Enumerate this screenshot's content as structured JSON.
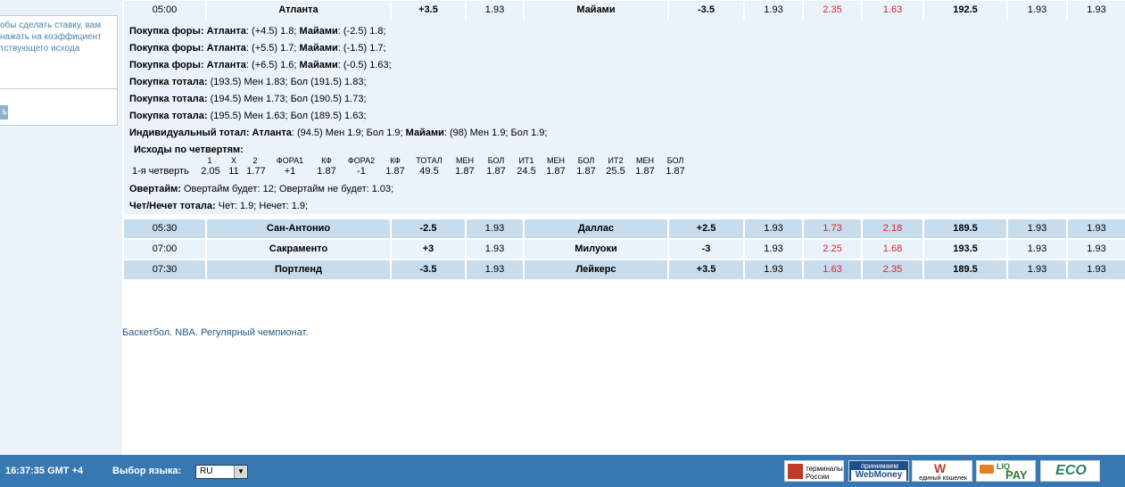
{
  "sidebar": {
    "lines": [
      "обы сделать ставку, вам",
      "нажать на коэффициент",
      "тствующего исхода"
    ],
    "button_label": "ь"
  },
  "matches": [
    {
      "time": "05:00",
      "team1": "Атланта",
      "fora1": "+3.5",
      "k1": "1.93",
      "team2": "Майами",
      "fora2": "-3.5",
      "k2": "1.93",
      "r1": "2.35",
      "r2": "1.63",
      "total": "192.5",
      "t1": "1.93",
      "t2": "1.93"
    },
    {
      "time": "05:30",
      "team1": "Сан-Антонио",
      "fora1": "-2.5",
      "k1": "1.93",
      "team2": "Даллас",
      "fora2": "+2.5",
      "k2": "1.93",
      "r1": "1.73",
      "r2": "2.18",
      "total": "189.5",
      "t1": "1.93",
      "t2": "1.93"
    },
    {
      "time": "07:00",
      "team1": "Сакраменто",
      "fora1": "+3",
      "k1": "1.93",
      "team2": "Милуоки",
      "fora2": "-3",
      "k2": "1.93",
      "r1": "2.25",
      "r2": "1.68",
      "total": "193.5",
      "t1": "1.93",
      "t2": "1.93"
    },
    {
      "time": "07:30",
      "team1": "Портленд",
      "fora1": "-3.5",
      "k1": "1.93",
      "team2": "Лейкерс",
      "fora2": "+3.5",
      "k2": "1.93",
      "r1": "1.63",
      "r2": "2.35",
      "total": "189.5",
      "t1": "1.93",
      "t2": "1.93"
    }
  ],
  "details": {
    "fora1": {
      "label": "Покупка форы:",
      "team1": "Атланта",
      "v1": ": (+4.5) 1.8;",
      "team2": "Майами",
      "v2": ": (-2.5) 1.8;"
    },
    "fora2": {
      "label": "Покупка форы:",
      "team1": "Атланта",
      "v1": ": (+5.5) 1.7;",
      "team2": "Майами",
      "v2": ": (-1.5) 1.7;"
    },
    "fora3": {
      "label": "Покупка форы:",
      "team1": "Атланта",
      "v1": ": (+6.5) 1.6;",
      "team2": "Майами",
      "v2": ": (-0.5) 1.63;"
    },
    "total1": {
      "label": "Покупка тотала:",
      "v": " (193.5) Мен 1.83; Бол (191.5) 1.83;"
    },
    "total2": {
      "label": "Покупка тотала:",
      "v": " (194.5) Мен 1.73; Бол (190.5) 1.73;"
    },
    "total3": {
      "label": "Покупка тотала:",
      "v": " (195.5) Мен 1.63; Бол (189.5) 1.63;"
    },
    "individual": {
      "label": "Индивидуальный тотал:",
      "team1": "Атланта",
      "v1": ": (94.5) Мен 1.9; Бол 1.9;",
      "team2": "Майами",
      "v2": ": (98) Мен 1.9; Бол 1.9;"
    },
    "quarters_title": "Исходы по четвертям:",
    "quarters_headers": [
      "1",
      "X",
      "2",
      "ФОРА1",
      "КФ",
      "ФОРА2",
      "КФ",
      "ТОТАЛ",
      "МЕН",
      "БОЛ",
      "ИТ1",
      "МЕН",
      "БОЛ",
      "ИТ2",
      "МЕН",
      "БОЛ"
    ],
    "quarter_row_label": "1-я четверть",
    "quarter_values": [
      "2.05",
      "11",
      "1.77",
      "+1",
      "1.87",
      "-1",
      "1.87",
      "49.5",
      "1.87",
      "1.87",
      "24.5",
      "1.87",
      "1.87",
      "25.5",
      "1.87",
      "1.87"
    ],
    "overtime": {
      "label": "Овертайм:",
      "v": " Овертайм будет: 12; Овертайм не будет: 1.03;"
    },
    "evenodd": {
      "label": "Чет/Нечет тотала:",
      "v": " Чет: 1.9; Нечет: 1.9;"
    }
  },
  "league": "Баскетбол. NBA. Регулярный чемпионат.",
  "footer": {
    "clock": "16:37:35  GMT +4",
    "lang_label": "Выбор языка:",
    "lang_value": "RU",
    "logos": {
      "terminals": "терминалы России",
      "webmoney_top": "принимаем",
      "webmoney": "WebMoney",
      "wallet": "единый кошелек",
      "liqpay_top": "LIQ",
      "liqpay": "PAY",
      "eco": "ECO"
    }
  }
}
